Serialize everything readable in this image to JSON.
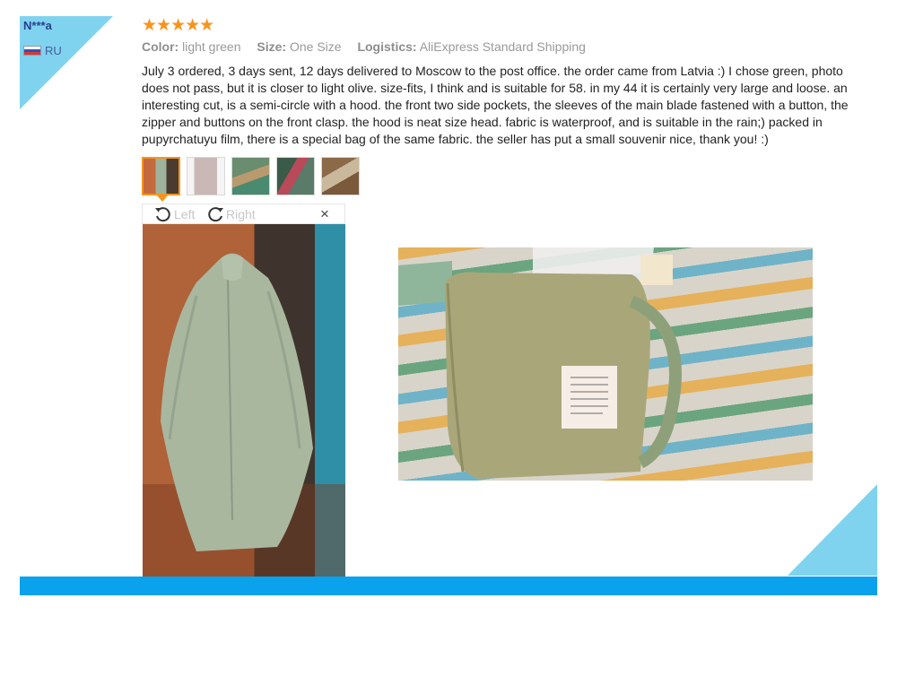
{
  "reviewer": {
    "name": "N***a",
    "country": "RU"
  },
  "rating": {
    "stars_text": "★★★★★",
    "value": 5,
    "max": 5,
    "color": "#f7941d"
  },
  "attributes": {
    "color_key": "Color:",
    "color_value": "light green",
    "size_key": "Size:",
    "size_value": "One Size",
    "logistics_key": "Logistics:",
    "logistics_value": "AliExpress Standard Shipping"
  },
  "review_text": "July 3 ordered, 3 days sent, 12 days delivered to Moscow to the post office. the order came from Latvia :) I chose green, photo does not pass, but it is closer to light olive. size-fits, I think and is suitable for 58. in my 44 it is certainly very large and loose. an interesting cut, is a semi-circle with a hood. the front two side pockets, the sleeves of the main blade fastened with a button, the zipper and buttons on the front clasp. the hood is neat size head. fabric is waterproof, and is suitable in the rain;) packed in pupyrchatuyu film, there is a special bag of the same fabric. the seller has put a small souvenir nice, thank you! :)",
  "thumbnails": {
    "count": 5,
    "selected_index": 0
  },
  "viewer": {
    "rotate_left_label": "Left",
    "rotate_right_label": "Right",
    "close_label": "×"
  },
  "colors": {
    "accent_blue": "#0aa2ec",
    "corner_light_blue": "#7fd3ef",
    "star_orange": "#f7941d",
    "name_blue": "#2a3e8e"
  }
}
